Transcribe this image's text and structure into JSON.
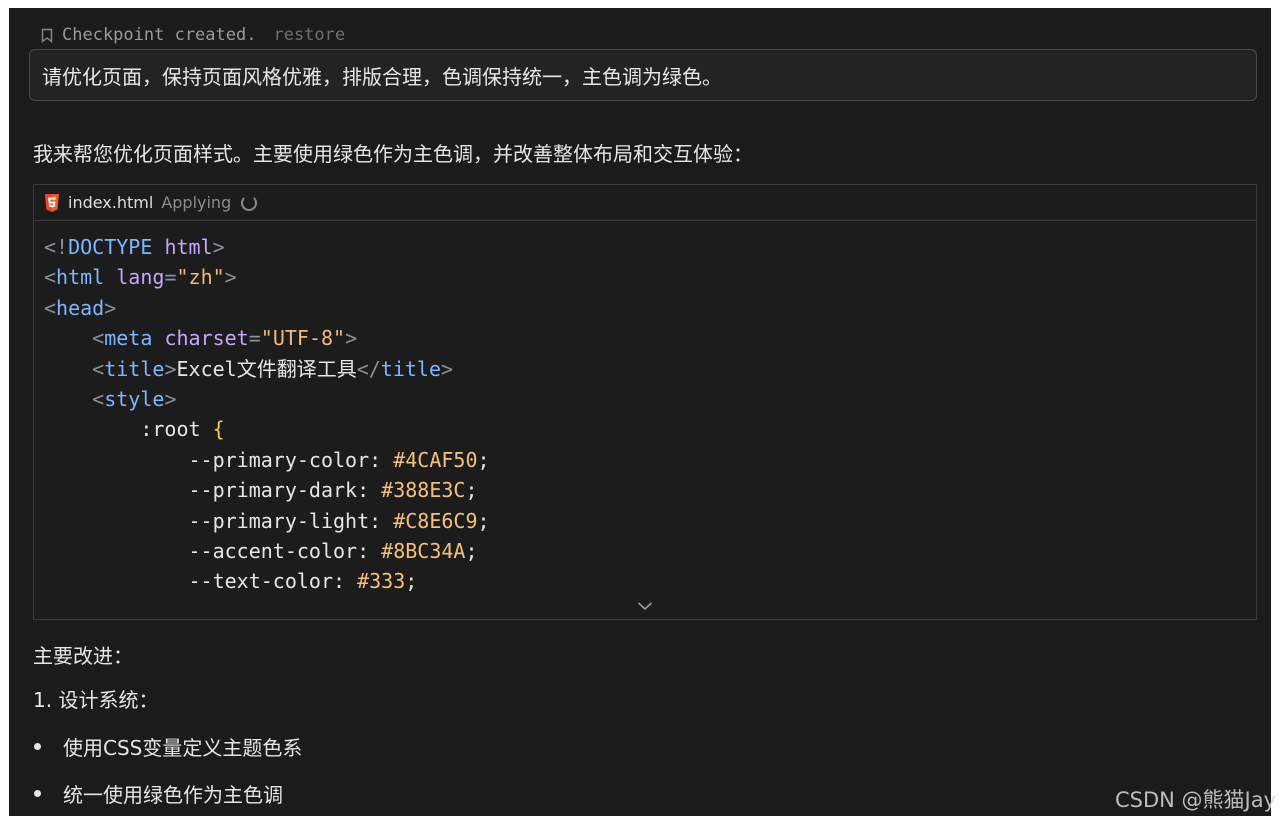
{
  "checkpoint": {
    "label": "Checkpoint created.",
    "restore_label": "restore"
  },
  "prompt": {
    "text": "请优化页面，保持页面风格优雅，排版合理，色调保持统一，主色调为绿色。"
  },
  "reply": {
    "intro": "我来帮您优化页面样式。主要使用绿色作为主色调，并改善整体布局和交互体验："
  },
  "code_block": {
    "filename": "index.html",
    "status": "Applying",
    "file_icon": "html5-icon",
    "lines": [
      [
        [
          "punc",
          "<!"
        ],
        [
          "tag",
          "DOCTYPE"
        ],
        [
          "text",
          " "
        ],
        [
          "attr",
          "html"
        ],
        [
          "punc",
          ">"
        ]
      ],
      [
        [
          "punc",
          "<"
        ],
        [
          "tag",
          "html"
        ],
        [
          "text",
          " "
        ],
        [
          "attr",
          "lang"
        ],
        [
          "punc",
          "="
        ],
        [
          "str",
          "\"zh\""
        ],
        [
          "punc",
          ">"
        ]
      ],
      [
        [
          "punc",
          "<"
        ],
        [
          "tag",
          "head"
        ],
        [
          "punc",
          ">"
        ]
      ],
      [
        [
          "text",
          "    "
        ],
        [
          "punc",
          "<"
        ],
        [
          "tag",
          "meta"
        ],
        [
          "text",
          " "
        ],
        [
          "attr",
          "charset"
        ],
        [
          "punc",
          "="
        ],
        [
          "str",
          "\"UTF-8\""
        ],
        [
          "punc",
          ">"
        ]
      ],
      [
        [
          "text",
          "    "
        ],
        [
          "punc",
          "<"
        ],
        [
          "tag",
          "title"
        ],
        [
          "punc",
          ">"
        ],
        [
          "text",
          "Excel文件翻译工具"
        ],
        [
          "punc",
          "</"
        ],
        [
          "tag",
          "title"
        ],
        [
          "punc",
          ">"
        ]
      ],
      [
        [
          "text",
          "    "
        ],
        [
          "punc",
          "<"
        ],
        [
          "tag",
          "style"
        ],
        [
          "punc",
          ">"
        ]
      ],
      [
        [
          "text",
          "        :root "
        ],
        [
          "brace",
          "{"
        ]
      ],
      [
        [
          "text",
          "            --primary-color: "
        ],
        [
          "val",
          "#4CAF50"
        ],
        [
          "text",
          ";"
        ]
      ],
      [
        [
          "text",
          "            --primary-dark: "
        ],
        [
          "val",
          "#388E3C"
        ],
        [
          "text",
          ";"
        ]
      ],
      [
        [
          "text",
          "            --primary-light: "
        ],
        [
          "val",
          "#C8E6C9"
        ],
        [
          "text",
          ";"
        ]
      ],
      [
        [
          "text",
          "            --accent-color: "
        ],
        [
          "val",
          "#8BC34A"
        ],
        [
          "text",
          ";"
        ]
      ],
      [
        [
          "text",
          "            --text-color: "
        ],
        [
          "val",
          "#333"
        ],
        [
          "text",
          ";"
        ]
      ]
    ]
  },
  "improvements": {
    "title": "主要改进：",
    "numbered_item": "1. 设计系统：",
    "bullets": [
      "使用CSS变量定义主题色系",
      "统一使用绿色作为主色调"
    ]
  },
  "watermark": "CSDN @熊猫Jay",
  "colors": {
    "background": "#1b1b1b",
    "tag": "#7cb7ff",
    "attribute": "#c6a5ff",
    "string": "#f3b97a",
    "brace": "#f1d04f",
    "html5_orange": "#e44d26"
  }
}
